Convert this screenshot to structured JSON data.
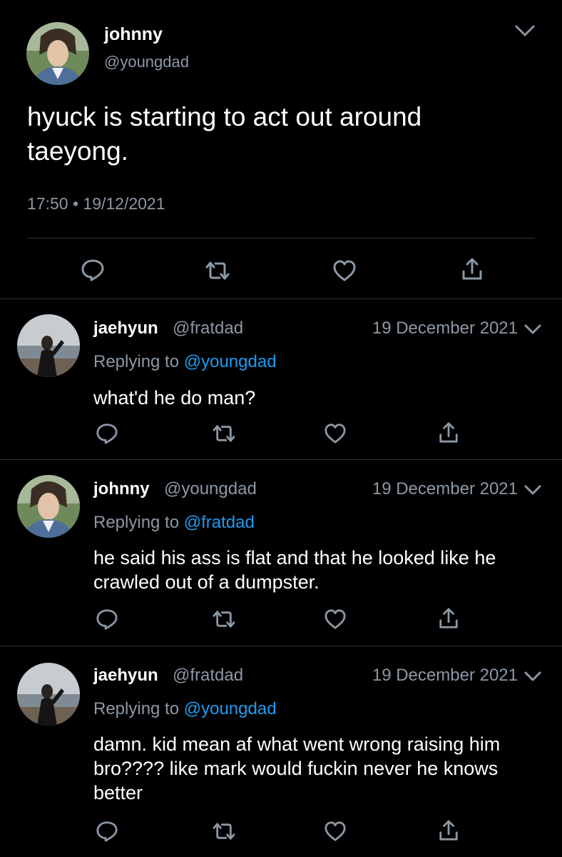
{
  "main_tweet": {
    "name": "johnny",
    "handle": "@youngdad",
    "text": "hyuck is starting to act out around taeyong.",
    "time": "17:50",
    "separator": "•",
    "date": "19/12/2021",
    "icons": [
      "reply-icon",
      "retweet-icon",
      "like-icon",
      "share-icon"
    ]
  },
  "replies": [
    {
      "name": "jaehyun",
      "handle": "@fratdad",
      "date": "19 December 2021",
      "replying_prefix": "Replying to",
      "replying_to": "@youngdad",
      "text": "what'd he do man?"
    },
    {
      "name": "johnny",
      "handle": "@youngdad",
      "date": "19 December 2021",
      "replying_prefix": "Replying to",
      "replying_to": "@fratdad",
      "text": "he said his ass is flat and that he looked like he crawled out of a dumpster."
    },
    {
      "name": "jaehyun",
      "handle": "@fratdad",
      "date": "19 December 2021",
      "replying_prefix": "Replying to",
      "replying_to": "@youngdad",
      "text": "damn. kid mean af what went wrong raising him bro???? like mark would fuckin never he knows better"
    }
  ],
  "colors": {
    "background": "#000000",
    "text": "#ffffff",
    "secondary": "#8b98a5",
    "mention": "#1d9bf0",
    "divider": "#333333"
  }
}
